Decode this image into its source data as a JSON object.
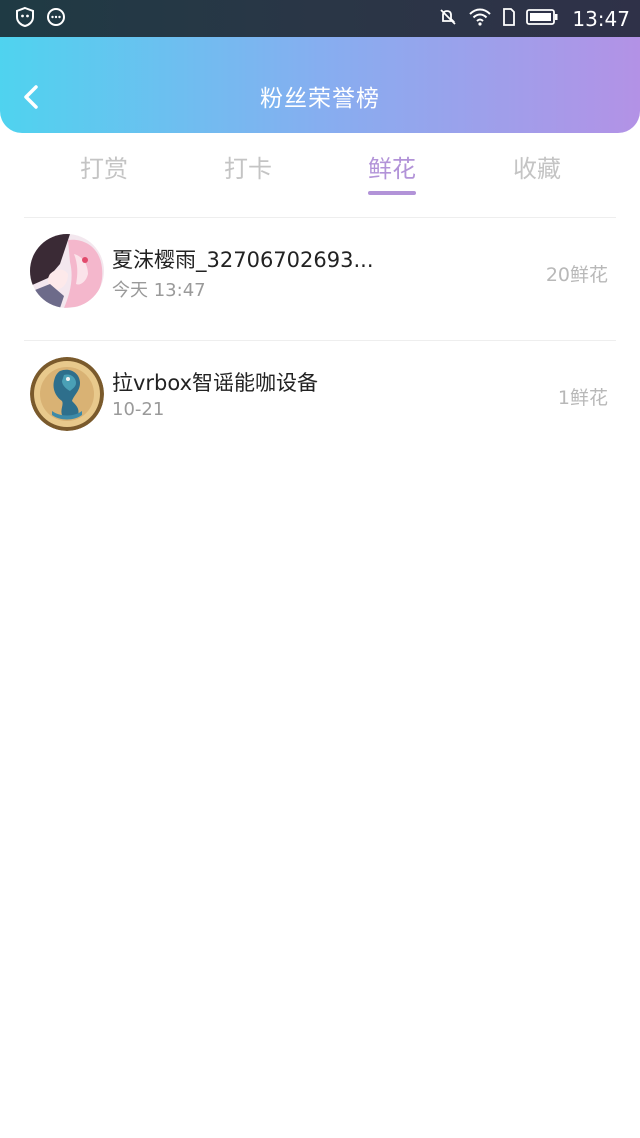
{
  "status_bar": {
    "time": "13:47",
    "left_icons": [
      "shield-icon",
      "message-dots-icon"
    ],
    "right_icons": [
      "mute-icon",
      "wifi-icon",
      "sim-icon",
      "battery-icon"
    ]
  },
  "header": {
    "title": "粉丝荣誉榜",
    "back_icon": "chevron-left-icon",
    "gradient_colors": [
      "#4fd3ef",
      "#86aef0",
      "#b392e6"
    ]
  },
  "tabs": [
    {
      "label": "打赏",
      "active": false
    },
    {
      "label": "打卡",
      "active": false
    },
    {
      "label": "鲜花",
      "active": true
    },
    {
      "label": "收藏",
      "active": false
    }
  ],
  "accent_color": "#b293d8",
  "list": [
    {
      "name": "夏沫樱雨_32706702693...",
      "time": "今天 13:47",
      "count": "20鲜花",
      "avatar": "anime-girl-avatar"
    },
    {
      "name": "拉vrbox智谣能咖设备",
      "time": "10-21",
      "count": "1鲜花",
      "avatar": "dragon-badge-avatar"
    }
  ]
}
